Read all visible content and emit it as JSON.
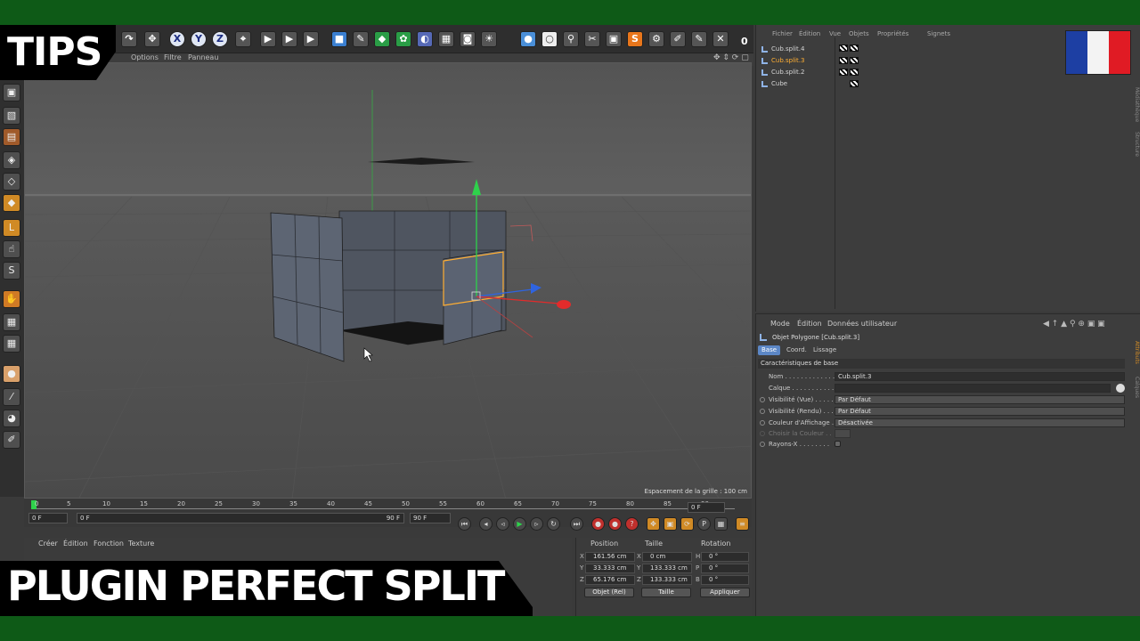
{
  "overlay": {
    "tips": "TIPS",
    "title": "PLUGIN PERFECT SPLIT",
    "flag_colors": [
      "#1d3fa3",
      "#f3f3f3",
      "#e01b24"
    ]
  },
  "colors": {
    "frame_green": "#0e5a17",
    "selection_orange": "#ffae33",
    "axis_x": "#e22b2b",
    "axis_y": "#2ed24b",
    "axis_z": "#2f64e0",
    "active_tab": "#5c87c6"
  },
  "toolbar": {
    "axis_x": "X",
    "axis_y": "Y",
    "axis_z": "Z",
    "frame_counter": "0"
  },
  "viewport_menu": {
    "options": "Options",
    "filtre": "Filtre",
    "panneau": "Panneau"
  },
  "viewport": {
    "grid_spacing": "Espacement de la grille : 100 cm"
  },
  "timeline": {
    "ticks": [
      "0",
      "5",
      "10",
      "15",
      "20",
      "25",
      "30",
      "35",
      "40",
      "45",
      "50",
      "55",
      "60",
      "65",
      "70",
      "75",
      "80",
      "85",
      "90"
    ],
    "current_frame": "0 F",
    "start_frame": "0 F",
    "slider_start": "0 F",
    "slider_end": "90 F",
    "end_frame": "90 F"
  },
  "material_menu": {
    "creer": "Créer",
    "edition": "Édition",
    "fonction": "Fonction",
    "texture": "Texture"
  },
  "coordinates": {
    "headers": {
      "position": "Position",
      "taille": "Taille",
      "rotation": "Rotation"
    },
    "position": {
      "x": "161.56 cm",
      "y": "33.333 cm",
      "z": "65.176 cm"
    },
    "size": {
      "x": "0 cm",
      "y": "133.333 cm",
      "z": "133.333 cm"
    },
    "rotation": {
      "h": "0 °",
      "p": "0 °",
      "b": "0 °"
    },
    "axis_labels": {
      "x": "X",
      "y": "Y",
      "z": "Z",
      "h": "H",
      "p": "P",
      "b": "B"
    },
    "mode_select": "Objet (Rel)",
    "size_select": "Taille",
    "apply_button": "Appliquer"
  },
  "object_manager": {
    "menu": [
      "Fichier",
      "Édition",
      "Vue",
      "Objets",
      "Propriétés",
      "Signets"
    ],
    "objects": [
      {
        "name": "Cub.split.4",
        "selected": false
      },
      {
        "name": "Cub.split.3",
        "selected": true
      },
      {
        "name": "Cub.split.2",
        "selected": false
      },
      {
        "name": "Cube",
        "selected": false
      }
    ],
    "side_tabs": [
      "Médiathèque",
      "Structure"
    ]
  },
  "attribute_manager": {
    "menu": {
      "mode": "Mode",
      "edition": "Édition",
      "user_data": "Données utilisateur"
    },
    "object_title": "Objet Polygone [Cub.split.3]",
    "tabs": [
      "Base",
      "Coord.",
      "Lissage"
    ],
    "section": "Caractéristiques de base",
    "fields": {
      "nom_label": "Nom . . . . . . . . . . . . . .",
      "nom_value": "Cub.split.3",
      "calque_label": "Calque . . . . . . . . . . . . .",
      "calque_value": "",
      "vis_vue_label": "Visibilité (Vue) . . . . .",
      "vis_vue_value": "Par Défaut",
      "vis_rendu_label": "Visibilité (Rendu) . . . .",
      "vis_rendu_value": "Par Défaut",
      "couleur_label": "Couleur d'Affichage . .",
      "couleur_value": "Désactivée",
      "choisir_label": "Choisir la Couleur . .",
      "rayons_label": "Rayons-X . . . . . . . ."
    },
    "side_tabs": [
      "Attributs",
      "Calques"
    ]
  }
}
